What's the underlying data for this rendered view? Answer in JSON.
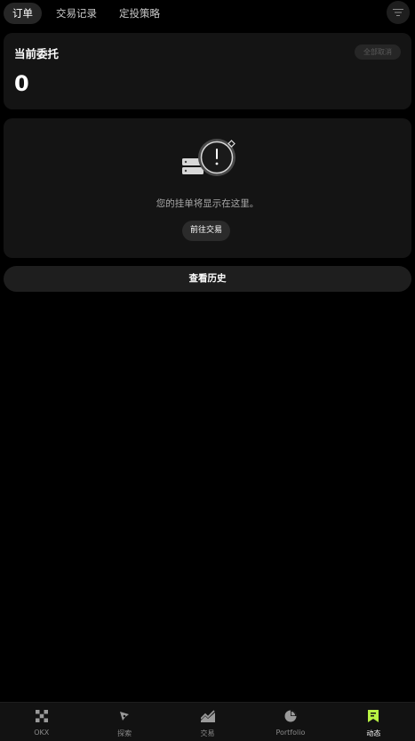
{
  "tabs": [
    {
      "label": "订单",
      "active": true
    },
    {
      "label": "交易记录",
      "active": false
    },
    {
      "label": "定投策略",
      "active": false
    }
  ],
  "orders_card": {
    "title": "当前委托",
    "cancel_all": "全部取消",
    "count": "0"
  },
  "empty_state": {
    "message": "您的挂单将显示在这里。",
    "action": "前往交易",
    "icon": "alert-icon"
  },
  "history_button": "查看历史",
  "bottom_nav": [
    {
      "label": "OKX",
      "icon": "okx-logo-icon",
      "active": false
    },
    {
      "label": "探索",
      "icon": "compass-icon",
      "active": false
    },
    {
      "label": "交易",
      "icon": "chart-icon",
      "active": false
    },
    {
      "label": "Portfolio",
      "icon": "pie-chart-icon",
      "active": false
    },
    {
      "label": "动态",
      "icon": "bookmark-icon",
      "active": true
    }
  ],
  "colors": {
    "background": "#000000",
    "card": "#141414",
    "accent": "#b8f243"
  }
}
